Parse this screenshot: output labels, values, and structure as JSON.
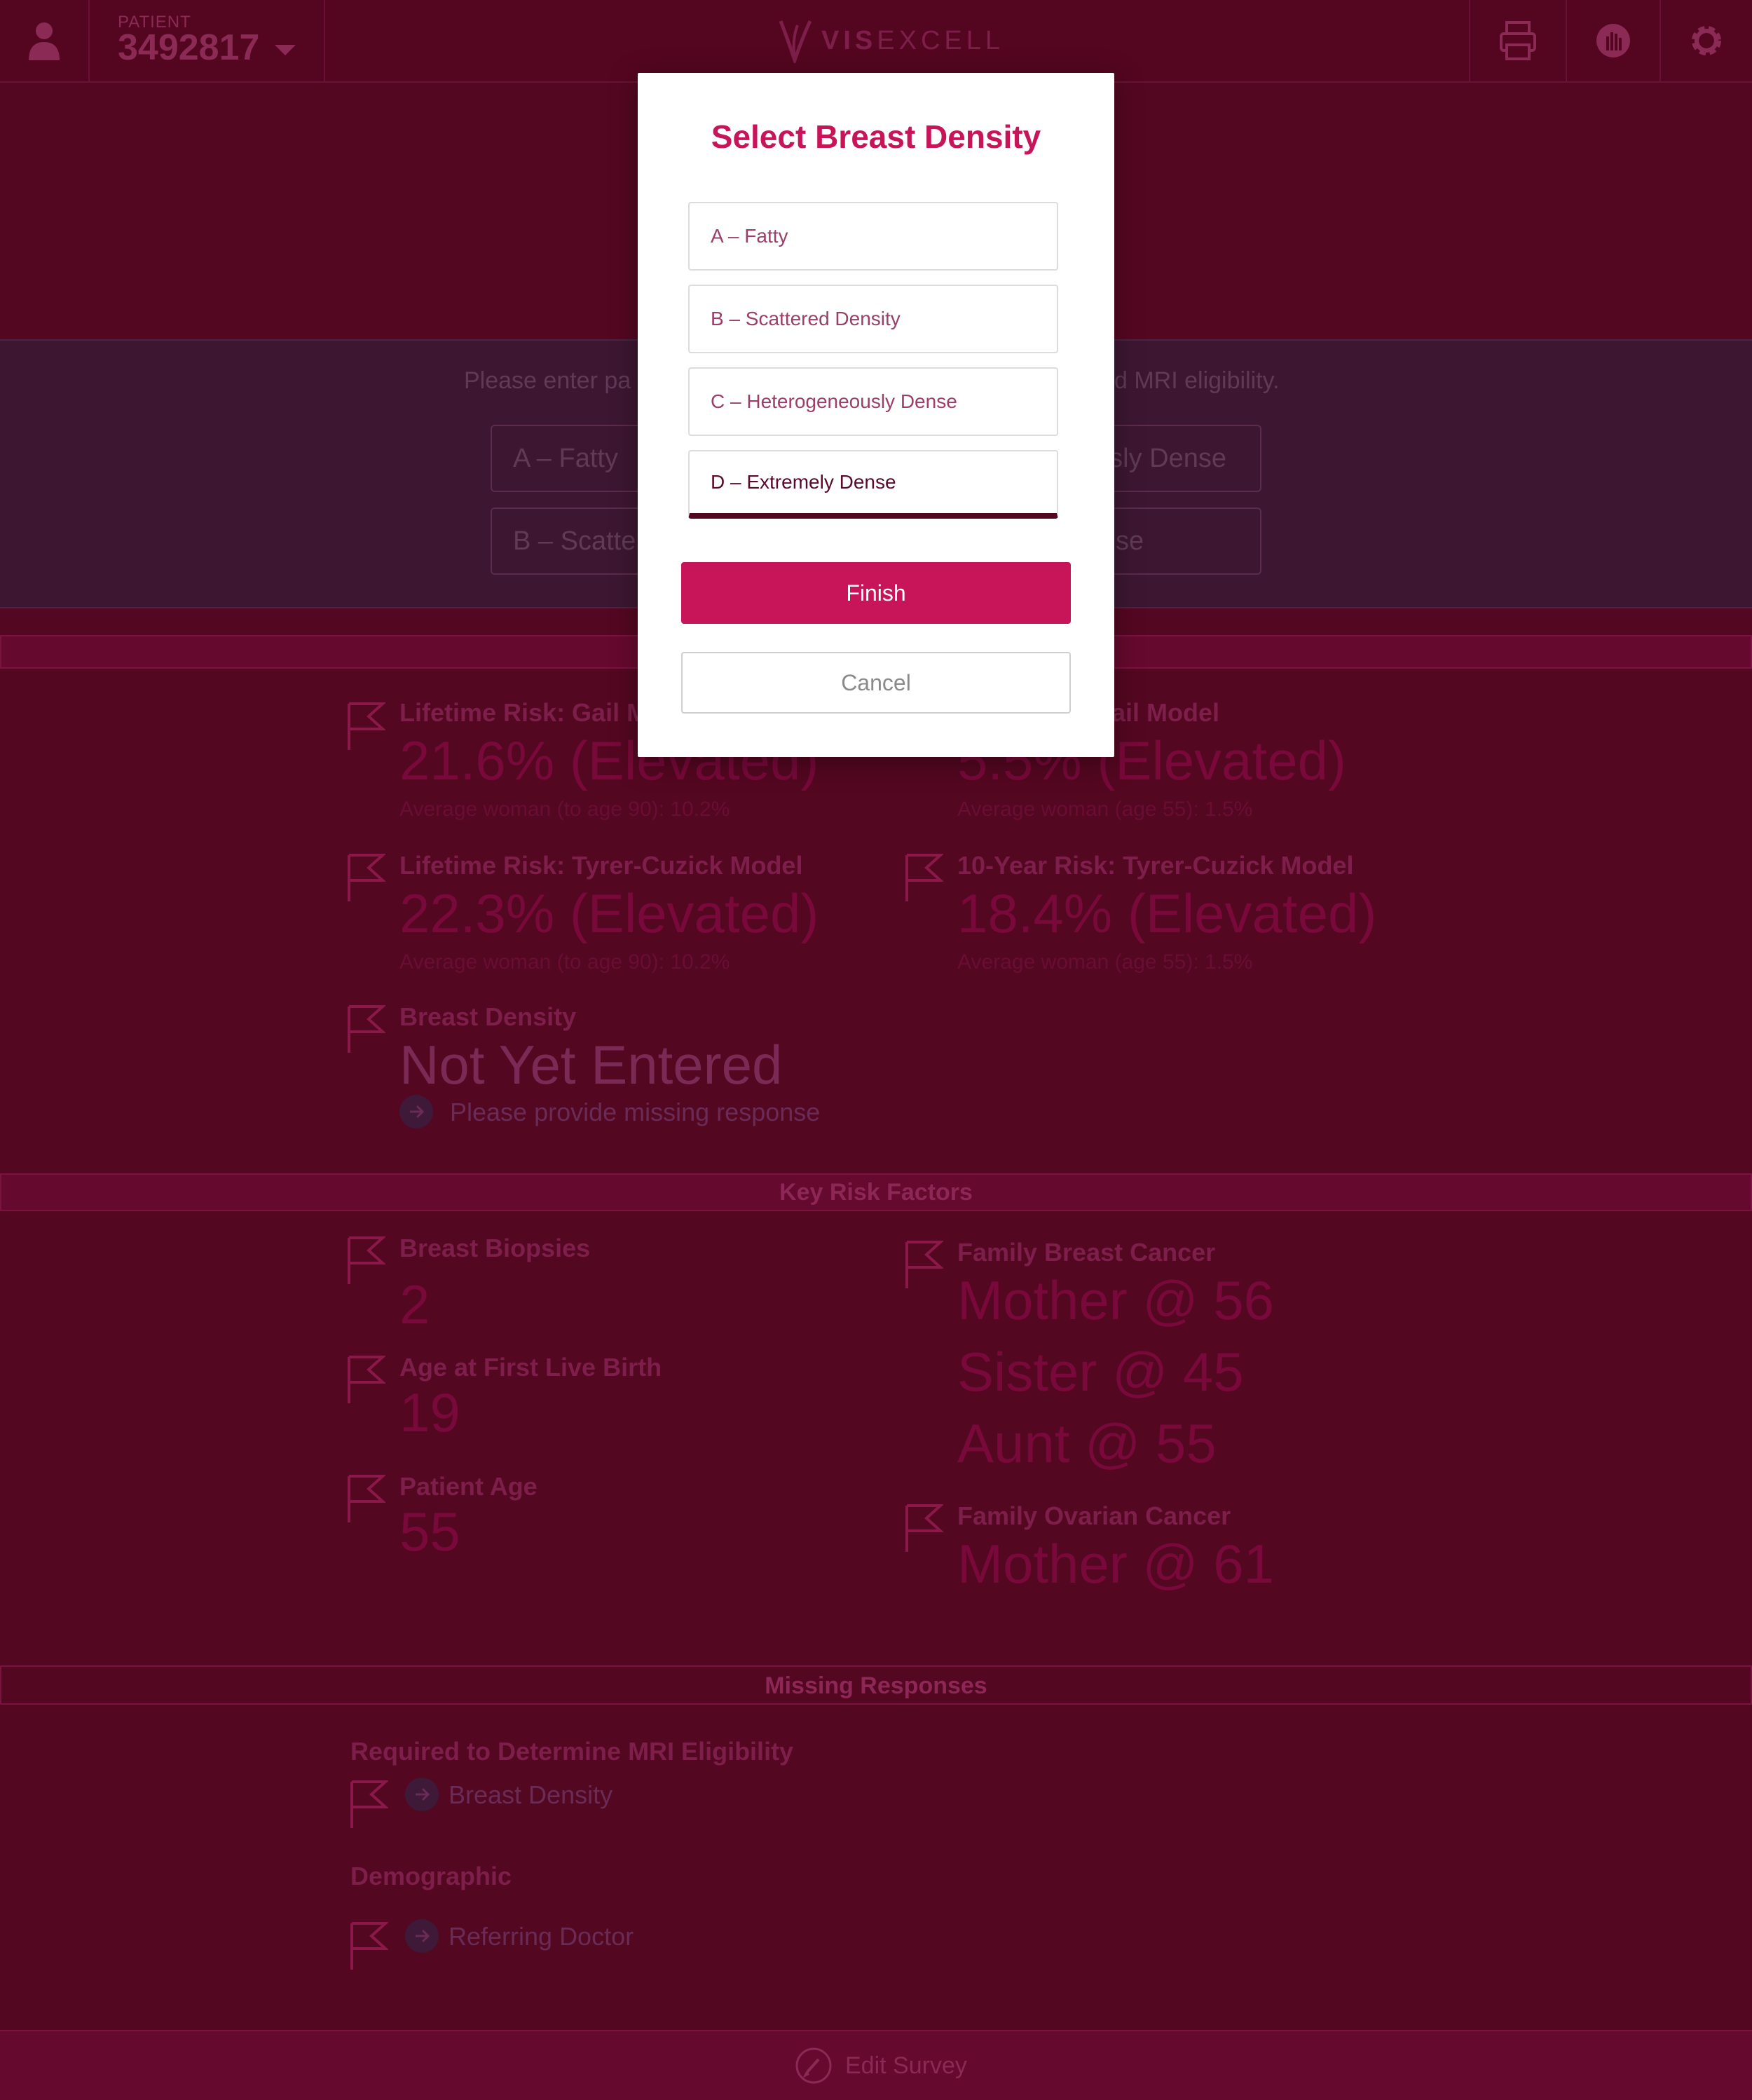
{
  "header": {
    "patient_caption": "PATIENT",
    "patient_id": "3492817",
    "logo_bold": "VIS",
    "logo_rest": "EXCELL"
  },
  "banner": {
    "instruction_left": "Please enter pa",
    "instruction_right": "d MRI eligibility.",
    "options": [
      "A – Fatty",
      "B – Scattere",
      "sly Dense",
      "se"
    ]
  },
  "risk": {
    "items": [
      {
        "label": "Lifetime Risk: Gail M",
        "value": "21.6% (Elevated)",
        "avg": "Average woman (to age 90): 10.2%"
      },
      {
        "label": "ail Model",
        "value": "5.5% (Elevated)",
        "avg": "Average woman (age 55): 1.5%"
      },
      {
        "label": "Lifetime Risk: Tyrer-Cuzick Model",
        "value": "22.3% (Elevated)",
        "avg": "Average woman (to age 90): 10.2%"
      },
      {
        "label": "10-Year Risk: Tyrer-Cuzick Model",
        "value": "18.4% (Elevated)",
        "avg": "Average woman (age 55): 1.5%"
      }
    ],
    "density_label": "Breast Density",
    "density_value": "Not Yet Entered",
    "density_note": "Please provide missing response"
  },
  "key_risk": {
    "title": "Key Risk Factors",
    "biopsies_label": "Breast Biopsies",
    "biopsies_value": "2",
    "birth_label": "Age at First Live Birth",
    "birth_value": "19",
    "age_label": "Patient Age",
    "age_value": "55",
    "family_breast_label": "Family Breast Cancer",
    "family_breast_values": [
      "Mother @ 56",
      "Sister @ 45",
      "Aunt @ 55"
    ],
    "family_ovarian_label": "Family Ovarian Cancer",
    "family_ovarian_value": "Mother @ 61"
  },
  "missing": {
    "title": "Missing Responses",
    "required_heading": "Required to Determine MRI Eligibility",
    "required_item": "Breast Density",
    "demographic_heading": "Demographic",
    "demographic_item": "Referring Doctor"
  },
  "footer": {
    "edit_label": "Edit Survey"
  },
  "modal": {
    "title": "Select Breast Density",
    "options": [
      "A – Fatty",
      "B – Scattered Density",
      "C – Heterogeneously Dense",
      "D – Extremely Dense"
    ],
    "selected_index": 3,
    "finish_label": "Finish",
    "cancel_label": "Cancel"
  },
  "colors": {
    "accent": "#c8155a",
    "background": "#540721"
  },
  "icons": [
    "user-icon",
    "print-icon",
    "hand-icon",
    "gear-icon",
    "flag-icon",
    "arrow-icon",
    "pencil-icon"
  ]
}
